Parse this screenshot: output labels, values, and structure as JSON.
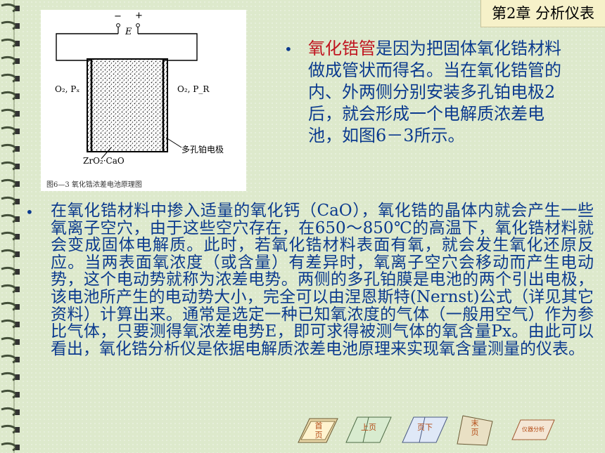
{
  "chapter_label": "第2章  分析仪表",
  "figure": {
    "caption": "图6—3  氧化锆浓差电池原理图",
    "minus_sign": "−",
    "plus_sign": "+",
    "E_label": "E",
    "left_gas": "O₂, Pₓ",
    "right_gas": "O₂, P_R",
    "electrode_label": "多孔铂电极",
    "material_label": "ZrO₂·CaO"
  },
  "paragraph1": {
    "highlight": "氧化锆管",
    "text": "是因为把固体氧化锆材料做成管状而得名。当在氧化锆管的内、外两侧分别安装多孔铂电极2后，就会形成一个电解质浓差电池，如图6－3所示。"
  },
  "paragraph2": {
    "text": "在氧化锆材料中掺入适量的氧化钙（CaO），氧化锆的晶体内就会产生一些氧离子空穴，由于这些空穴存在，在650～850℃的高温下，氧化锆材料就会变成固体电解质。此时，若氧化锆材料表面有氧，就会发生氧化还原反应。当两表面氧浓度（或含量）有差异时，氧离子空穴会移动而产生电动势，这个电动势就称为浓差电势。两侧的多孔铂膜是电池的两个引出电极，该电池所产生的电动势大小，完全可以由涅恩斯特(Nernst)公式（详见其它资料）计算出来。通常是选定一种已知氧浓度的气体（一般用空气）作为参比气体，只要测得氧浓差电势E，即可求得被测气体的氧含量Px。由此可以看出，氧化锆分析仪是依据电解质浓差电池原理来实现氧含量测量的仪表。"
  },
  "nav": {
    "first": "首页",
    "prev": "上页",
    "next": "页下",
    "last": "末页",
    "toc": "仪器分析"
  },
  "colors": {
    "text": "#0b3a8e",
    "highlight": "#c0141f",
    "background": "#dde9cc"
  }
}
